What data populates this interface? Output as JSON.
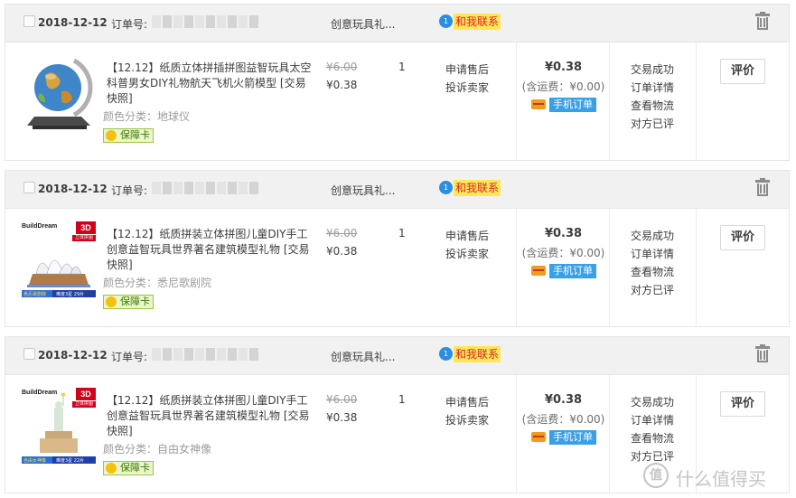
{
  "orders": [
    {
      "date": "2018-12-12",
      "order_no_label": "订单号:",
      "shop": "创意玩具礼...",
      "contact": "和我联系",
      "title": "【12.12】纸质立体拼插拼图益智玩具太空科普男女DIY礼物航天飞机火箭模型 [交易快照]",
      "sku": "颜色分类：地球仪",
      "guarantee": "保障卡",
      "price_original": "¥6.00",
      "price_now": "¥0.38",
      "quantity": "1",
      "service": [
        "申请售后",
        "投诉卖家"
      ],
      "total": "¥0.38",
      "shipping": "(含运费：¥0.00)",
      "mobile_order": "手机订单",
      "status": [
        "交易成功",
        "订单详情",
        "查看物流",
        "对方已评"
      ],
      "review_button": "评价",
      "thumb_icon": "globe-icon"
    },
    {
      "date": "2018-12-12",
      "order_no_label": "订单号:",
      "shop": "创意玩具礼...",
      "contact": "和我联系",
      "title": "【12.12】纸质拼装立体拼图儿童DIY手工创意益智玩具世界著名建筑模型礼物 [交易快照]",
      "sku": "颜色分类：悉尼歌剧院",
      "guarantee": "保障卡",
      "price_original": "¥6.00",
      "price_now": "¥0.38",
      "quantity": "1",
      "service": [
        "申请售后",
        "投诉卖家"
      ],
      "total": "¥0.38",
      "shipping": "(含运费：¥0.00)",
      "mobile_order": "手机订单",
      "status": [
        "交易成功",
        "订单详情",
        "查看物流",
        "对方已评"
      ],
      "review_button": "评价",
      "thumb_icon": "opera-house-icon",
      "thumb_text": {
        "brand": "BuildDream",
        "badge": "3D",
        "badge_sub": "立体拼图",
        "name": "悉尼歌剧院",
        "spec": "难度3星 29片"
      }
    },
    {
      "date": "2018-12-12",
      "order_no_label": "订单号:",
      "shop": "创意玩具礼...",
      "contact": "和我联系",
      "title": "【12.12】纸质拼装立体拼图儿童DIY手工创意益智玩具世界著名建筑模型礼物 [交易快照]",
      "sku": "颜色分类：自由女神像",
      "guarantee": "保障卡",
      "price_original": "¥6.00",
      "price_now": "¥0.38",
      "quantity": "1",
      "service": [
        "申请售后",
        "投诉卖家"
      ],
      "total": "¥0.38",
      "shipping": "(含运费：¥0.00)",
      "mobile_order": "手机订单",
      "status": [
        "交易成功",
        "订单详情",
        "查看物流",
        "对方已评"
      ],
      "review_button": "评价",
      "thumb_icon": "statue-of-liberty-icon",
      "thumb_text": {
        "brand": "BuildDream",
        "badge": "3D",
        "badge_sub": "立体拼图",
        "name": "自由女神像",
        "spec": "难度3星 22片"
      }
    }
  ],
  "watermark": {
    "icon": "值",
    "text": "什么值得买"
  }
}
